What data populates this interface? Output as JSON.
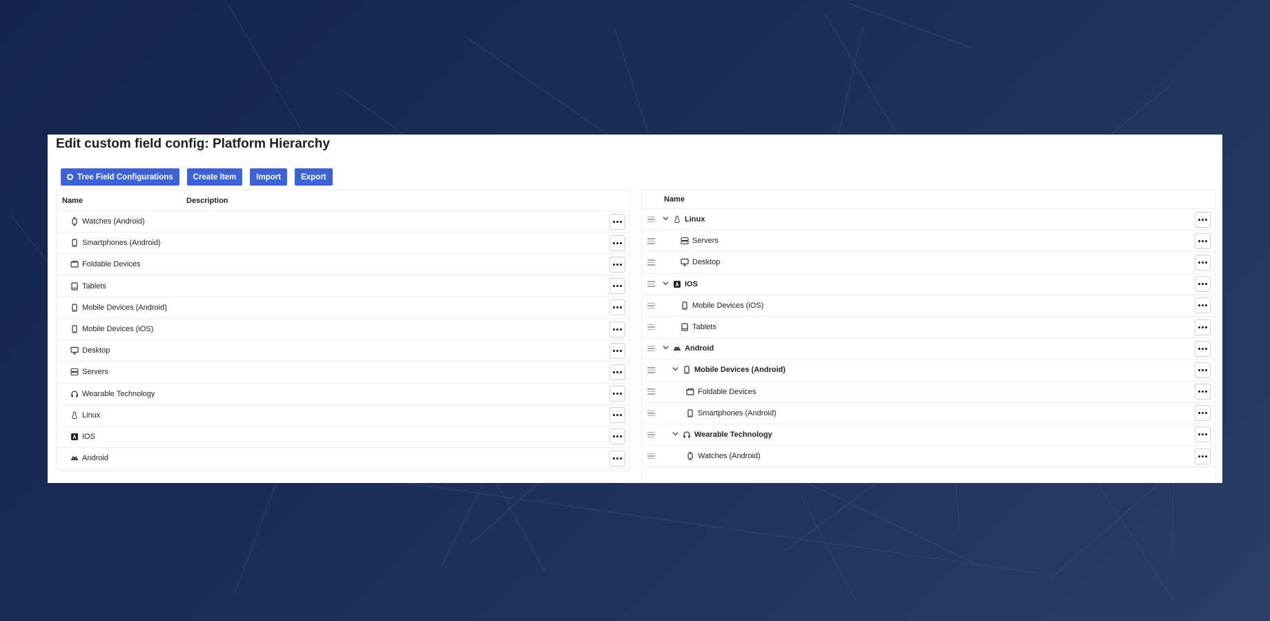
{
  "page_title": "Edit custom field config: Platform Hierarchy",
  "toolbar": {
    "tree_config_label": "Tree Field Configurations",
    "create_label": "Create Item",
    "import_label": "Import",
    "export_label": "Export"
  },
  "left_table": {
    "headers": {
      "name": "Name",
      "description": "Description"
    },
    "rows": [
      {
        "label": "Watches (Android)",
        "icon": "watch-icon"
      },
      {
        "label": "Smartphones (Android)",
        "icon": "phone-icon"
      },
      {
        "label": "Foldable Devices",
        "icon": "foldable-icon"
      },
      {
        "label": "Tablets",
        "icon": "tablet-icon"
      },
      {
        "label": "Mobile Devices (Android)",
        "icon": "phone-icon"
      },
      {
        "label": "Mobile Devices (iOS)",
        "icon": "phone-icon"
      },
      {
        "label": "Desktop",
        "icon": "desktop-icon"
      },
      {
        "label": "Servers",
        "icon": "server-icon"
      },
      {
        "label": "Wearable Technology",
        "icon": "headphones-icon"
      },
      {
        "label": "Linux",
        "icon": "linux-icon"
      },
      {
        "label": "IOS",
        "icon": "app-store-icon"
      },
      {
        "label": "Android",
        "icon": "android-icon"
      }
    ]
  },
  "right_tree": {
    "header": "Name",
    "rows": [
      {
        "label": "Linux",
        "icon": "linux-icon",
        "level": 0,
        "expandable": true,
        "bold": true
      },
      {
        "label": "Servers",
        "icon": "server-icon",
        "level": 1,
        "expandable": false,
        "bold": false
      },
      {
        "label": "Desktop",
        "icon": "desktop-icon",
        "level": 1,
        "expandable": false,
        "bold": false
      },
      {
        "label": "IOS",
        "icon": "app-store-icon",
        "level": 0,
        "expandable": true,
        "bold": true
      },
      {
        "label": "Mobile Devices (iOS)",
        "icon": "phone-icon",
        "level": 1,
        "expandable": false,
        "bold": false
      },
      {
        "label": "Tablets",
        "icon": "tablet-icon",
        "level": 1,
        "expandable": false,
        "bold": false
      },
      {
        "label": "Android",
        "icon": "android-icon",
        "level": 0,
        "expandable": true,
        "bold": true
      },
      {
        "label": "Mobile Devices (Android)",
        "icon": "phone-icon",
        "level": 1,
        "expandable": true,
        "bold": true
      },
      {
        "label": "Foldable Devices",
        "icon": "foldable-icon",
        "level": 2,
        "expandable": false,
        "bold": false
      },
      {
        "label": "Smartphones (Android)",
        "icon": "phone-icon",
        "level": 2,
        "expandable": false,
        "bold": false
      },
      {
        "label": "Wearable Technology",
        "icon": "headphones-icon",
        "level": 1,
        "expandable": true,
        "bold": true
      },
      {
        "label": "Watches (Android)",
        "icon": "watch-icon",
        "level": 2,
        "expandable": false,
        "bold": false
      }
    ]
  },
  "colors": {
    "accent": "#3c63d1",
    "background": "#1b2f55"
  }
}
